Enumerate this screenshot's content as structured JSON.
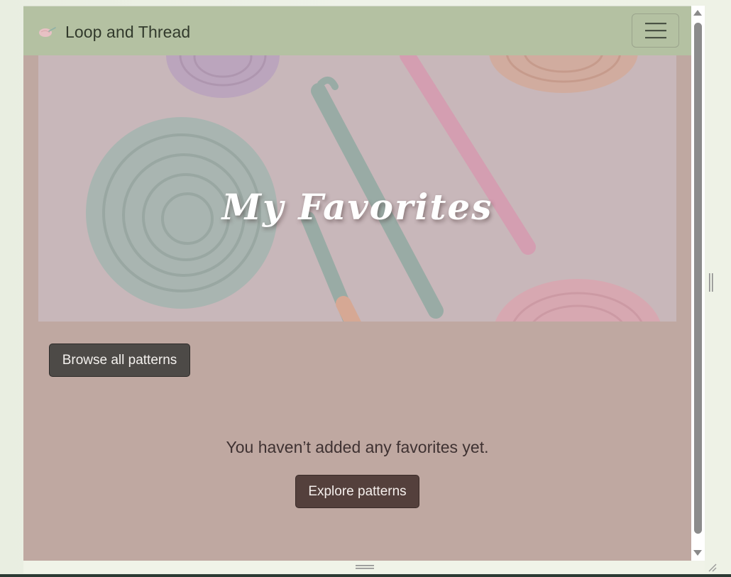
{
  "navbar": {
    "brand_name": "Loop and Thread",
    "logo_icon": "yarn-logo-icon",
    "menu_icon": "hamburger-menu-icon",
    "background": "#b4c1a2"
  },
  "hero": {
    "title": "My Favorites",
    "image_description_icon": "yarn-and-crochet-hooks-image"
  },
  "actions": {
    "browse_all_label": "Browse all patterns",
    "explore_label": "Explore patterns"
  },
  "empty_state": {
    "message": "You haven’t added any favorites yet."
  },
  "colors": {
    "page_background": "#bfa8a1",
    "browse_button": "#4d4a47",
    "explore_button": "#54403c"
  }
}
